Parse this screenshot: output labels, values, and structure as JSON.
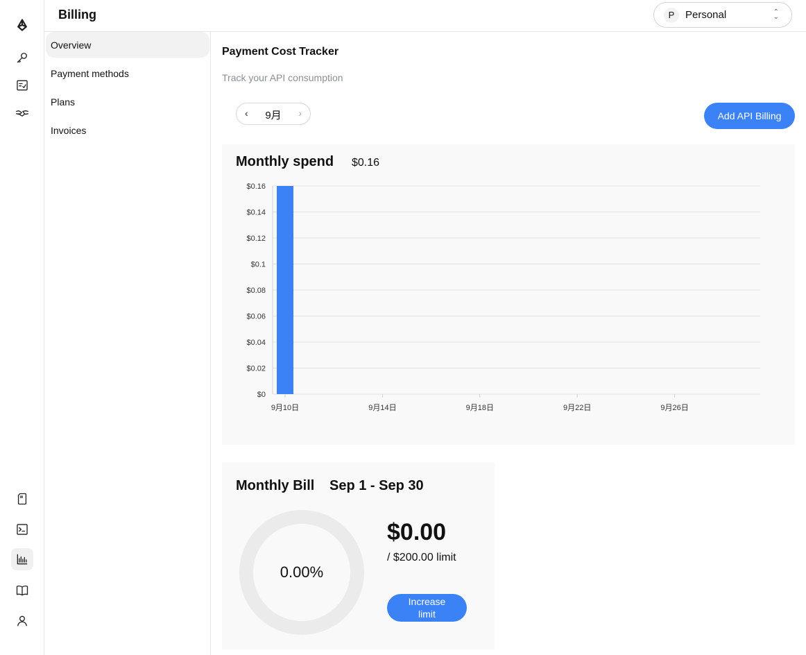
{
  "rail": {
    "top_icons": [
      "logo-icon",
      "key-icon",
      "task-list-icon",
      "handshake-icon"
    ],
    "bottom_icons": [
      "document-icon",
      "terminal-icon",
      "bar-chart-icon",
      "book-icon",
      "user-icon"
    ],
    "active": "bar-chart-icon"
  },
  "header": {
    "title": "Billing",
    "workspace": {
      "initial": "P",
      "name": "Personal",
      "chevron": "⌃⌄"
    }
  },
  "subnav": {
    "items": [
      {
        "label": "Overview",
        "active": true
      },
      {
        "label": "Payment methods",
        "active": false
      },
      {
        "label": "Plans",
        "active": false
      },
      {
        "label": "Invoices",
        "active": false
      }
    ]
  },
  "main": {
    "title": "Payment Cost Tracker",
    "subtitle": "Track your API consumption",
    "month_picker": {
      "prev": "‹",
      "label": "9月",
      "next": "›"
    },
    "add_billing_label": "Add API Billing",
    "spend": {
      "title": "Monthly spend",
      "amount": "$0.16"
    },
    "bill": {
      "title": "Monthly Bill",
      "range": "Sep 1 - Sep 30",
      "percent_label": "0.00%",
      "percent": 0,
      "amount": "$0.00",
      "limit": "/ $200.00 limit",
      "increase_label": "Increase limit"
    }
  },
  "colors": {
    "accent": "#3b82f6",
    "card_bg": "#f9f9f9",
    "ring": "#ebebeb"
  },
  "chart_data": {
    "type": "bar",
    "title": "Monthly spend",
    "x_start_day": 10,
    "x_end_day": 30,
    "x_ticks": [
      {
        "day": 10,
        "label": "9月10日"
      },
      {
        "day": 14,
        "label": "9月14日"
      },
      {
        "day": 18,
        "label": "9月18日"
      },
      {
        "day": 22,
        "label": "9月22日"
      },
      {
        "day": 26,
        "label": "9月26日"
      }
    ],
    "y_ticks": [
      {
        "value": 0,
        "label": "$0"
      },
      {
        "value": 0.02,
        "label": "$0.02"
      },
      {
        "value": 0.04,
        "label": "$0.04"
      },
      {
        "value": 0.06,
        "label": "$0.06"
      },
      {
        "value": 0.08,
        "label": "$0.08"
      },
      {
        "value": 0.1,
        "label": "$0.1"
      },
      {
        "value": 0.12,
        "label": "$0.12"
      },
      {
        "value": 0.14,
        "label": "$0.14"
      },
      {
        "value": 0.16,
        "label": "$0.16"
      }
    ],
    "ylim": [
      0,
      0.16
    ],
    "bars": [
      {
        "day": 10,
        "value": 0.16
      }
    ],
    "bar_color": "#3b82f6",
    "grid": true
  }
}
